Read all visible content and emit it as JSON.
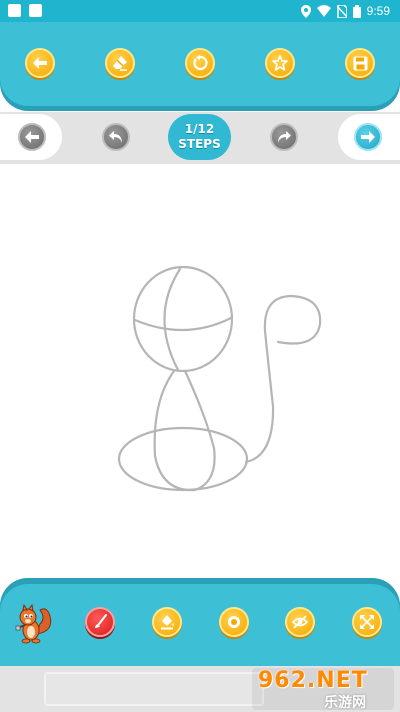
{
  "status_bar": {
    "time": "9:59",
    "icons": [
      "location-icon",
      "wifi-icon",
      "no-sim-icon",
      "battery-icon"
    ]
  },
  "top_toolbar": {
    "buttons": [
      "back-arrow-icon",
      "eraser-icon",
      "undo-icon",
      "star-icon",
      "save-icon"
    ]
  },
  "step_nav": {
    "step_count": "1/12",
    "steps_label": "STEPS",
    "buttons": [
      "prev-step-icon",
      "undo-stroke-icon",
      "redo-stroke-icon",
      "next-step-icon"
    ]
  },
  "bottom_toolbar": {
    "buttons": [
      "mascot-squirrel-icon",
      "brush-icon",
      "bucket-fill-icon",
      "stamp-icon",
      "hide-guide-icon",
      "fullscreen-icon"
    ]
  },
  "watermark": {
    "brand": "962.NET",
    "subtitle": "乐游网"
  },
  "colors": {
    "toolbar": "#3dbfd6",
    "status_bar": "#1fb5cf",
    "accent_yellow": "#f5a800",
    "accent_red": "#d81b1b",
    "step_badge": "#31b8d2",
    "sketch_line": "#b5b5b5"
  }
}
